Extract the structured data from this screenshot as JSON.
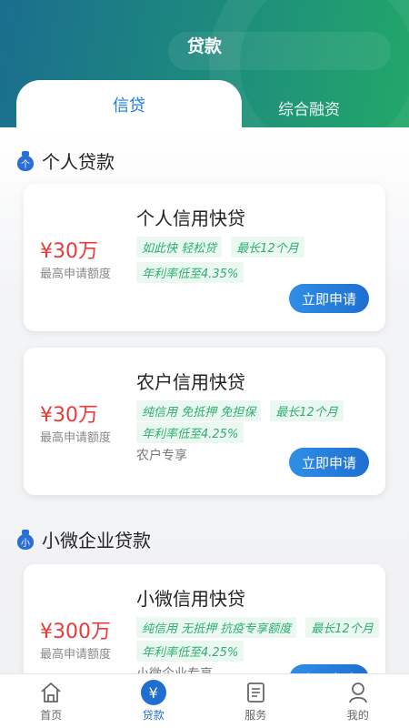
{
  "header": {
    "title": "贷款",
    "tabs": [
      {
        "label": "信贷",
        "active": true
      },
      {
        "label": "综合融资",
        "active": false
      }
    ]
  },
  "colors": {
    "header_gradient_start": "#1a6e8e",
    "header_gradient_end": "#22a76a",
    "accent_blue": "#1f6fd0",
    "amount_red": "#e83a3a",
    "tag_green": "#2fae73"
  },
  "sections": [
    {
      "title": "个人贷款",
      "icon_char": "个",
      "cards": [
        {
          "name": "个人信用快贷",
          "amount": "¥30万",
          "amount_label": "最高申请额度",
          "tags_row1": [
            "如此快 轻松贷",
            "最长12个月"
          ],
          "tags_row2": [
            "年利率低至4.35%"
          ],
          "note": "",
          "button": "立即申请"
        },
        {
          "name": "农户信用快贷",
          "amount": "¥30万",
          "amount_label": "最高申请额度",
          "tags_row1": [
            "纯信用 免抵押 免担保",
            "最长12个月"
          ],
          "tags_row2": [
            "年利率低至4.25%"
          ],
          "note": "农户专享",
          "button": "立即申请"
        }
      ]
    },
    {
      "title": "小微企业贷款",
      "icon_char": "小",
      "cards": [
        {
          "name": "小微信用快贷",
          "amount": "¥300万",
          "amount_label": "最高申请额度",
          "tags_row1": [
            "纯信用 无抵押 抗疫专享额度",
            "最长12个月"
          ],
          "tags_row2": [
            "年利率低至4.25%"
          ],
          "note": "小微企业专享",
          "button": "立即申请"
        }
      ]
    }
  ],
  "bottom_nav": [
    {
      "label": "首页",
      "icon": "home-icon",
      "active": false
    },
    {
      "label": "贷款",
      "icon": "loan-icon",
      "active": true
    },
    {
      "label": "服务",
      "icon": "service-icon",
      "active": false
    },
    {
      "label": "我的",
      "icon": "profile-icon",
      "active": false
    }
  ]
}
